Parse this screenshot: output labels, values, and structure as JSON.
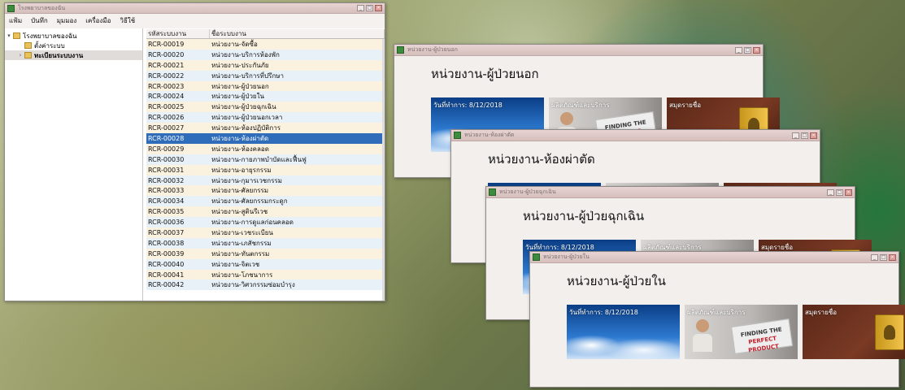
{
  "main_window": {
    "title": "โรงพยาบาลของฉัน",
    "menu": [
      "แฟ้ม",
      "บันทึก",
      "มุมมอง",
      "เครื่องมือ",
      "วิธีใช้"
    ],
    "tree": {
      "root": "โรงพยาบาลของฉัน",
      "children": [
        "ตั้งค่าระบบ",
        "ทะเบียนระบบงาน"
      ]
    },
    "grid": {
      "headers": [
        "รหัสระบบงาน",
        "ชื่อระบบงาน"
      ],
      "selected_index": 9,
      "rows": [
        [
          "RCR-00019",
          "หน่วยงาน-จัดซื้อ"
        ],
        [
          "RCR-00020",
          "หน่วยงาน-บริการห้องพัก"
        ],
        [
          "RCR-00021",
          "หน่วยงาน-ประกันภัย"
        ],
        [
          "RCR-00022",
          "หน่วยงาน-บริการที่ปรึกษา"
        ],
        [
          "RCR-00023",
          "หน่วยงาน-ผู้ป่วยนอก"
        ],
        [
          "RCR-00024",
          "หน่วยงาน-ผู้ป่วยใน"
        ],
        [
          "RCR-00025",
          "หน่วยงาน-ผู้ป่วยฉุกเฉิน"
        ],
        [
          "RCR-00026",
          "หน่วยงาน-ผู้ป่วยนอกเวลา"
        ],
        [
          "RCR-00027",
          "หน่วยงาน-ห้องปฏิบัติการ"
        ],
        [
          "RCR-00028",
          "หน่วยงาน-ห้องผ่าตัด"
        ],
        [
          "RCR-00029",
          "หน่วยงาน-ห้องคลอด"
        ],
        [
          "RCR-00030",
          "หน่วยงาน-กายภาพบำบัดและฟื้นฟู"
        ],
        [
          "RCR-00031",
          "หน่วยงาน-อายุรกรรม"
        ],
        [
          "RCR-00032",
          "หน่วยงาน-กุมารเวชกรรม"
        ],
        [
          "RCR-00033",
          "หน่วยงาน-ศัลยกรรม"
        ],
        [
          "RCR-00034",
          "หน่วยงาน-ศัลยกรรมกระดูก"
        ],
        [
          "RCR-00035",
          "หน่วยงาน-สูตินรีเวช"
        ],
        [
          "RCR-00036",
          "หน่วยงาน-การดูแลก่อนคลอด"
        ],
        [
          "RCR-00037",
          "หน่วยงาน-เวชระเบียน"
        ],
        [
          "RCR-00038",
          "หน่วยงาน-เภสัชกรรม"
        ],
        [
          "RCR-00039",
          "หน่วยงาน-ทันตกรรม"
        ],
        [
          "RCR-00040",
          "หน่วยงาน-จิตเวช"
        ],
        [
          "RCR-00041",
          "หน่วยงาน-โภชนาการ"
        ],
        [
          "RCR-00042",
          "หน่วยงาน-วิศวกรรมซ่อมบำรุง"
        ]
      ]
    }
  },
  "dept_windows": [
    {
      "title": "หน่วยงาน-ผู้ป่วยนอก",
      "heading": "หน่วยงาน-ผู้ป่วยนอก",
      "date_label": "วันที่ทำการ: 8/12/2018",
      "tile2_label": "ผลิตภัณฑ์และบริการ",
      "tile3_label": "สมุดรายชื่อ"
    },
    {
      "title": "หน่วยงาน-ห้องผ่าตัด",
      "heading": "หน่วยงาน-ห้องผ่าตัด",
      "date_label": "",
      "tile2_label": "",
      "tile3_label": ""
    },
    {
      "title": "หน่วยงาน-ผู้ป่วยฉุกเฉิน",
      "heading": "หน่วยงาน-ผู้ป่วยฉุกเฉิน",
      "date_label": "วันที่ทำการ: 8/12/2018",
      "tile2_label": "ผลิตภัณฑ์และบริการ",
      "tile3_label": "สมุดรายชื่อ"
    },
    {
      "title": "หน่วยงาน-ผู้ป่วยใน",
      "heading": "หน่วยงาน-ผู้ป่วยใน",
      "date_label": "วันที่ทำการ: 8/12/2018",
      "tile2_label": "ผลิตภัณฑ์และบริการ",
      "tile3_label": "สมุดรายชื่อ"
    }
  ],
  "product_card": {
    "line1": "FINDING THE",
    "line2": "PERFECT PRODUCT"
  },
  "colors": {
    "selection": "#2f6dba",
    "titlebar": "#d6bfbd"
  }
}
